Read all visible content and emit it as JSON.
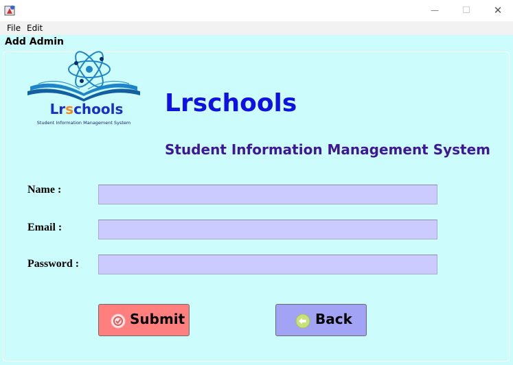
{
  "window": {
    "minimize_glyph": "—",
    "maximize_glyph": "☐",
    "close_glyph": "✕"
  },
  "menu": {
    "items": [
      {
        "label": "File"
      },
      {
        "label": "Edit"
      }
    ]
  },
  "frame": {
    "title": "Add Admin"
  },
  "logo": {
    "word_prefix": "Lr",
    "word_o": "s",
    "word_suffix": "chools",
    "tagline": "Student Information Management System"
  },
  "header": {
    "title": "Lrschools",
    "subtitle": "Student Information Management System"
  },
  "form": {
    "name_label": "Name :",
    "name_value": "",
    "email_label": "Email :",
    "email_value": "",
    "password_label": "Password :",
    "password_value": ""
  },
  "buttons": {
    "submit_label": "Submit",
    "back_label": "Back"
  },
  "colors": {
    "background": "#ccfcfb",
    "input": "#cccbff",
    "submit": "#ff7f7f",
    "back": "#a3a3f6",
    "title_blue": "#1010e0",
    "subtitle_purple": "#3d1796"
  },
  "icons": {
    "app": "java-app-icon",
    "submit": "check-circle-icon",
    "back": "arrow-left-circle-icon"
  }
}
